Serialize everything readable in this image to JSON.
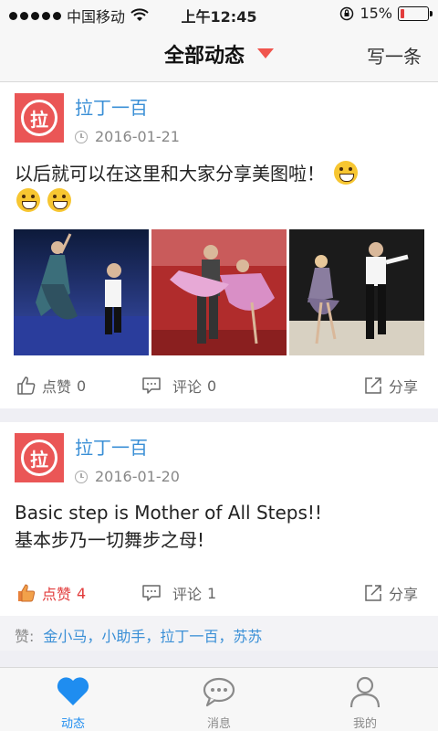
{
  "status_bar": {
    "carrier": "中国移动",
    "time": "上午12:45",
    "battery_percent": "15%",
    "battery_level": 0.15
  },
  "nav": {
    "title": "全部动态",
    "action": "写一条"
  },
  "posts": [
    {
      "author": "拉丁一百",
      "avatar_char": "拉",
      "date": "2016-01-21",
      "text": "以后就可以在这里和大家分享美图啦！",
      "images": [
        "dance-photo-1",
        "dance-photo-2",
        "dance-photo-3"
      ],
      "like_label": "点赞",
      "like_count": "0",
      "comment_label": "评论",
      "comment_count": "0",
      "share_label": "分享"
    },
    {
      "author": "拉丁一百",
      "avatar_char": "拉",
      "date": "2016-01-20",
      "text_line1": "Basic step is Mother of All Steps!!",
      "text_line2": "基本步乃一切舞步之母!",
      "like_label": "点赞",
      "like_count": "4",
      "comment_label": "评论",
      "comment_count": "1",
      "share_label": "分享",
      "likers_label": "赞:",
      "likers": "金小马，小助手，拉丁一百，苏苏"
    }
  ],
  "tabs": [
    {
      "label": "动态",
      "icon": "heart-icon",
      "active": true
    },
    {
      "label": "消息",
      "icon": "chat-icon",
      "active": false
    },
    {
      "label": "我的",
      "icon": "person-icon",
      "active": false
    }
  ],
  "colors": {
    "accent": "#1f8df0",
    "link": "#3a8fd6",
    "liked": "#e23b3b",
    "avatar_bg": "#ea5656"
  }
}
